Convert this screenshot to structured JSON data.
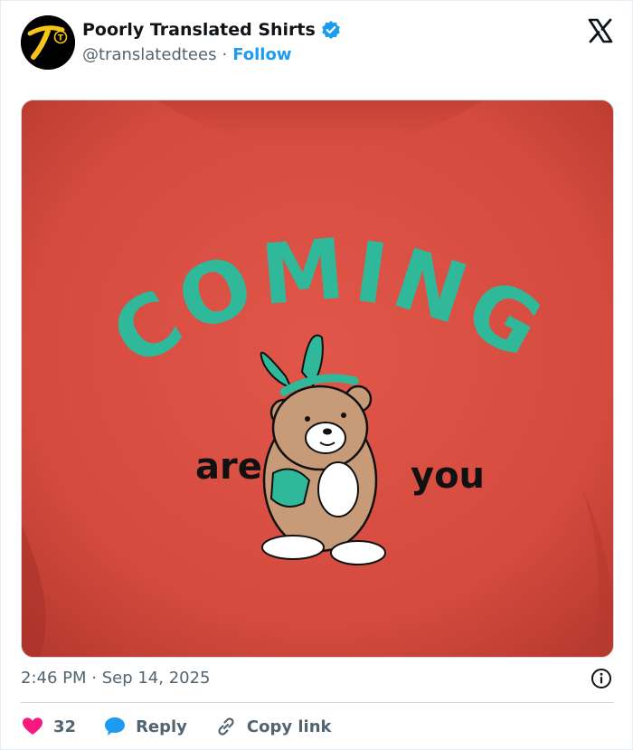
{
  "account": {
    "display_name": "Poorly Translated Shirts",
    "handle": "@translatedtees",
    "separator": "·",
    "follow_label": "Follow",
    "avatar_letter": "T",
    "verified": true
  },
  "media": {
    "shirt_text_top": "COMING",
    "shirt_text_left": "are",
    "shirt_text_right": "you"
  },
  "meta": {
    "timestamp": "2:46 PM · Sep 14, 2025"
  },
  "actions": {
    "like_count": "32",
    "reply_label": "Reply",
    "copy_label": "Copy link"
  },
  "colors": {
    "accent": "#1d9bf0",
    "like": "#f91880",
    "shirt": "#d8493e",
    "print_teal": "#2fb89a",
    "avatar_gold": "#f5c518"
  }
}
